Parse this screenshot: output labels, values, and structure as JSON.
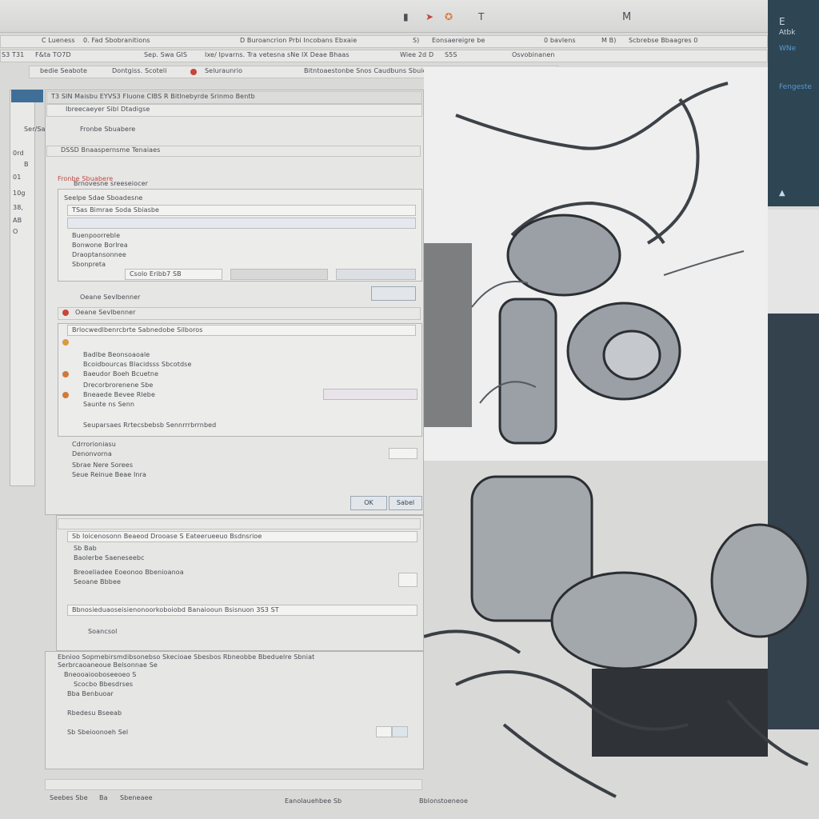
{
  "menubar": {
    "title": "M",
    "icons": [
      "document-icon",
      "cursor-icon",
      "color-wheel-icon",
      "text-icon"
    ],
    "row1": [
      "C Lueness",
      "0. Fad Sbobranitions",
      "D Buroancrion Prbi Incobans Ebxaie",
      "S)",
      "Eonsaereigre be",
      "0 bavlens",
      "M B)",
      "Scbrebse Bbaagres 0"
    ],
    "row2": [
      "S3 T31",
      "F&ta TO7D",
      "Sep. Swa GIS",
      "Ixe/ Ipvarns. Tra vetesna sNe IX Deae Bhaas",
      "Wiee 2d",
      "D",
      "S5S",
      "Osvobinanen"
    ]
  },
  "right_panel": {
    "items": [
      "E",
      "Atbk",
      "WNe",
      "Fengeste"
    ]
  },
  "toolbar": {
    "row": [
      "bedie Seabote",
      "Dontgiss. Scoteli",
      "Seluraunrio",
      "Bitntoaestonbe Snos Caudbuns Sbuio Bseusicmge Ce"
    ]
  },
  "sidebar": {
    "items": [
      "Ser/Sadtre",
      "0rd",
      "B",
      "01",
      "10g",
      "38,",
      "AB",
      "O"
    ]
  },
  "main_window": {
    "header": "T3 SIN Maisbu EYVS3 Fluone CIBS R Bitlnebyrde Srinmo Bentb",
    "subheader": "Ibreecaeyer Sibl Dtadigse",
    "section_title": "DSSD Bnaaspernsme Tenaiaes",
    "panel_label": "Fronbe Sbuabere",
    "panel_sublabel": "Brnovesne sreeseiocer",
    "list_header": "Seelpe Sdae Sboadesne",
    "dropdown": "TSas Bimrae Soda Sbiasbe",
    "lines": [
      "Buenpoorreble",
      "Bonwone Borlrea",
      "Draoptansonnee",
      "Sbonpreta"
    ],
    "input_value": "Csolo Eribb7 SB",
    "status": "Oeane Sevlbenner",
    "group_title": "Brlocwedlbenrcbrte Sabnedobe Silboros",
    "checklist": [
      "Badlbe Beonsoaoale",
      "Bcoidbourcas Blacidsss Sbcotdse",
      "Baeudor Boeh Bcuetne",
      "Drecorbrorenene Sbe",
      "Bneaede Bevee Rlebe",
      "Saunte ns Senn"
    ],
    "footer_line": "Seuparsaes Rrtecsbebsb Sennrrrbrrnbed",
    "options": [
      "Cdrrorioniasu",
      "Denonvorna",
      "Sbrae Nere Sorees",
      "Seue Reinue Beae Inra"
    ],
    "ok_label": "OK",
    "cancel_label": "Sabel"
  },
  "lower_window": {
    "header": "Sb Ioicenosonn Beaeod Drooase S Eateerueeuo Bsdnsrioe",
    "rows": [
      "Sb Bab",
      "Baolerbe Saeneseebc",
      "Breoeliadee Eoeonoo Bbenioanoa",
      "Seoane Bbbee"
    ],
    "group_header": "Bbnosieduaoseisienonoorkoboiobd Banaiooun Bsisnuon 3S3 ST",
    "group_row": "Soancsol"
  },
  "bottom_window": {
    "header": "Ebnioo Sopmebirsmdibsonebso Skecioae Sbesbos Rbneobbe Bbeduelre Sbniat",
    "rows": [
      "Serbrcaoaneoue Belsonnae Se",
      "Bneooaiooboseeoeo S",
      "Scocbo Bbesdrses",
      "Bba Benbuoar",
      "Rbedesu Bseeab",
      "Sb Sbeioonoeh Sel"
    ]
  },
  "statusbar": {
    "left": [
      "Seebes Sbe",
      "Ba",
      "Sbeneaee"
    ],
    "center": "Eanolauehbee  Sb",
    "right": "Bblonstoeneoe"
  }
}
